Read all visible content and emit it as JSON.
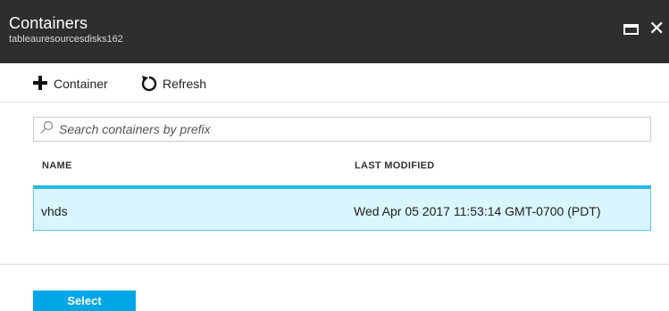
{
  "header": {
    "title": "Containers",
    "subtitle": "tableauresourcesdisks162",
    "maximize_icon": "maximize-icon",
    "close_icon": "close-icon",
    "close_glyph": "✕"
  },
  "toolbar": {
    "add_container_label": "Container",
    "add_icon": "plus-icon",
    "refresh_label": "Refresh",
    "refresh_icon": "refresh-icon"
  },
  "search": {
    "placeholder": "Search containers by prefix",
    "value": "",
    "icon": "search-icon"
  },
  "table": {
    "columns": [
      "NAME",
      "LAST MODIFIED"
    ],
    "rows": [
      {
        "name": "vhds",
        "last_modified": "Wed Apr 05 2017 11:53:14 GMT-0700 (PDT)",
        "selected": true
      }
    ]
  },
  "footer": {
    "select_label": "Select"
  },
  "colors": {
    "header_bg": "#2e2e2e",
    "selected_row_bg": "#d9f5fd",
    "selected_row_border": "#24b8e6",
    "primary_button": "#00a7e6"
  }
}
